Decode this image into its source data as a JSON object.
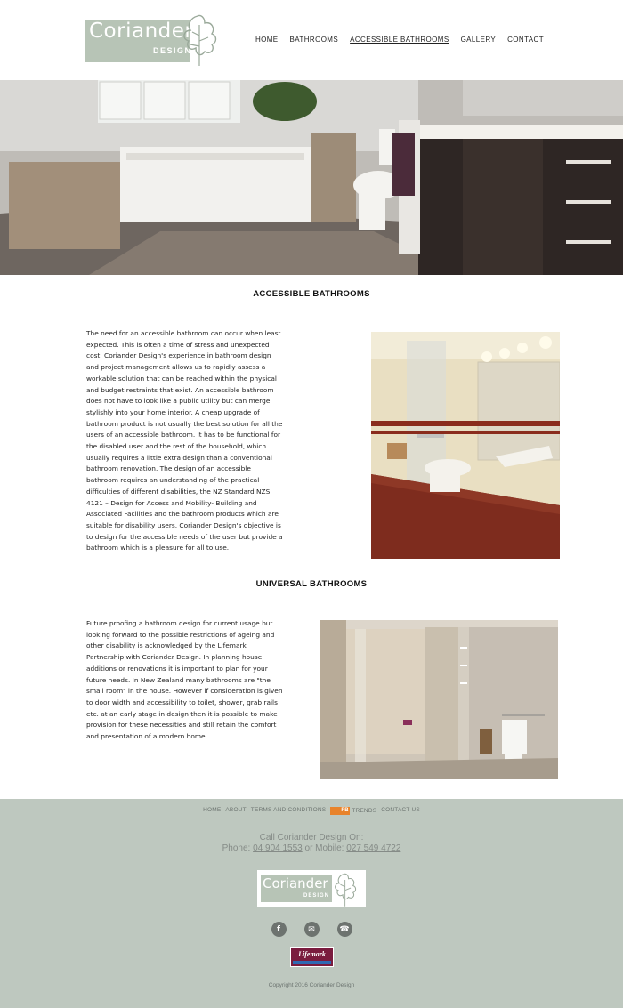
{
  "header": {
    "logo_text": "Coriander",
    "logo_sub": "DESIGN",
    "nav": [
      "HOME",
      "BATHROOMS",
      "ACCESSIBLE BATHROOMS",
      "GALLERY",
      "CONTACT"
    ]
  },
  "accessible": {
    "title": "ACCESSIBLE BATHROOMS",
    "text": "The need for an accessible bathroom can occur when least expected. This is often a time of stress and unexpected cost. Coriander Design's experience in bathroom design and project management allows us to rapidly assess a workable solution that can be reached within the physical and budget restraints that exist. An accessible bathroom does not have to look like a public utility but can merge stylishly into your home interior. A cheap upgrade of bathroom product is not usually the best solution for all the users of an accessible bathroom. It has to be functional for the disabled user and the rest of the household, which usually requires a little extra design than a conventional bathroom renovation. The design of an accessible bathroom requires an understanding of the practical difficulties of different disabilities, the NZ Standard NZS 4121 – Design for Access and Mobility- Building and Associated Facilities and the bathroom products which are suitable for disability users. Coriander Design's objective is to design for the accessible needs of the user but provide a bathroom which is a pleasure for all to use."
  },
  "universal": {
    "title": "UNIVERSAL BATHROOMS",
    "text": "Future proofing a bathroom design for current usage but looking forward to the possible restrictions of ageing and other disability is acknowledged by the Lifemark Partnership with Coriander Design. In planning house additions or renovations it is important to plan for your future needs. In New Zealand many bathrooms are \"the small room\" in the house. However if consideration is given to door width and accessibility to toilet, shower, grab rails etc. at an early stage in design then it is possible to make provision for these necessities and still retain the comfort and presentation of a modern home."
  },
  "footer": {
    "nav": [
      "HOME",
      "ABOUT",
      "TERMS AND CONDITIONS",
      "TRENDS",
      "CONTACT US"
    ],
    "rss_label": "FB",
    "call_line": "Call Coriander Design On:",
    "phone_label": "Phone:",
    "phone": "04 904 1553",
    "or_mobile": "or Mobile:",
    "mobile": "027 549 4722",
    "logo_text": "Coriander",
    "logo_sub": "DESIGN",
    "social": [
      "f",
      "✉",
      "☎"
    ],
    "lifemark": "Lifemark",
    "copyright": "Copyright 2016 Coriander Design"
  }
}
